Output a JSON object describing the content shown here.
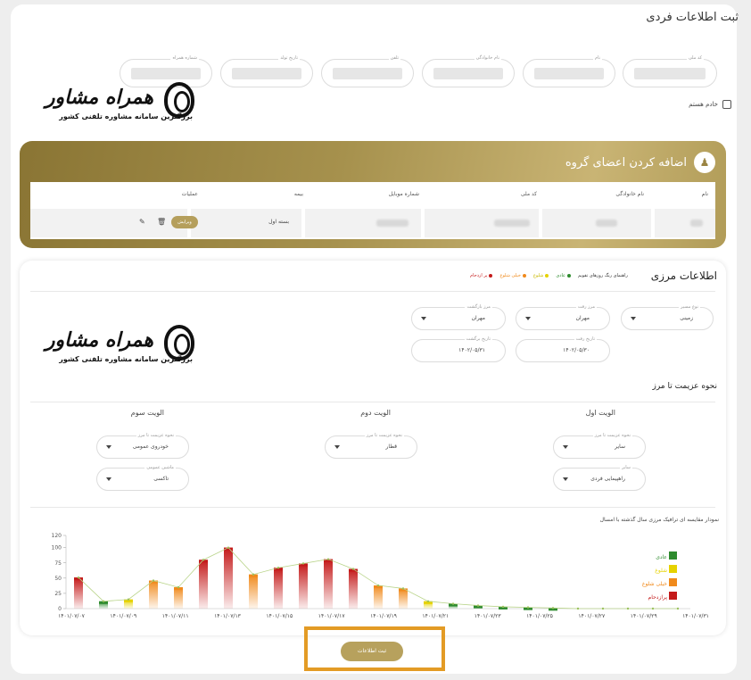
{
  "page_title": "ثبت اطلاعات فردی",
  "fields": [
    {
      "label": "کد ملی"
    },
    {
      "label": "نام"
    },
    {
      "label": "نام خانوادگی"
    },
    {
      "label": "تلفن"
    },
    {
      "label": "تاریخ تولد"
    },
    {
      "label": "شماره همراه"
    }
  ],
  "servant_checkbox_label": "خادم هستم",
  "watermark": {
    "brand": "همراه مشاور",
    "tagline": "بزرگترین سامانه مشاوره تلفنی کشور"
  },
  "group": {
    "title": "اضافه کردن اعضای گروه",
    "headers": {
      "name": "نام",
      "family": "نام خانوادگی",
      "national_code": "کد ملی",
      "mobile": "شماره موبایل",
      "insurance": "بیمه",
      "actions": "عملیات"
    },
    "row": {
      "insurance": "بسته اول",
      "edit_label": "ویرایش"
    }
  },
  "border": {
    "title": "اطلاعات مرزی",
    "legend": [
      {
        "label": "راهنمای رنگ روزهای تقویم",
        "color": ""
      },
      {
        "label": "عادی",
        "color": "#2e8b2e"
      },
      {
        "label": "شلوغ",
        "color": "#e6d200"
      },
      {
        "label": "خیلی شلوغ",
        "color": "#f08a1c"
      },
      {
        "label": "پر ازدحام",
        "color": "#c41a1a"
      }
    ],
    "selects": [
      {
        "label": "نوع مسیر",
        "value": "زمینی"
      },
      {
        "label": "مرز رفت",
        "value": "مهران"
      },
      {
        "label": "مرز بازگشت",
        "value": "مهران"
      }
    ],
    "dates": [
      {
        "label": "تاریخ رفت",
        "value": "۱۴۰۲/۰۵/۳۰"
      },
      {
        "label": "تاریخ برگشت",
        "value": "۱۴۰۲/۰۵/۳۱"
      }
    ],
    "priority_title": "نحوه عزیمت تا مرز",
    "priorities": [
      {
        "title": "الویت اول",
        "selects": [
          {
            "label": "نحوه عزیمت تا مرز",
            "value": "سایر"
          },
          {
            "label": "سایر",
            "value": "راهپیمایی فردی"
          }
        ]
      },
      {
        "title": "الویت دوم",
        "selects": [
          {
            "label": "نحوه عزیمت تا مرز",
            "value": "قطار"
          }
        ]
      },
      {
        "title": "الویت سوم",
        "selects": [
          {
            "label": "نحوه عزیمت تا مرز",
            "value": "خودروی عمومی"
          },
          {
            "label": "ماشین عمومی",
            "value": "تاکسی"
          }
        ]
      }
    ]
  },
  "chart_title": "نمودار مقایسه ای ترافیک مرزی سال گذشته با امسال",
  "chart_data": {
    "type": "bar",
    "title": "نمودار مقایسه ای ترافیک مرزی سال گذشته با امسال",
    "ylim": [
      0,
      120
    ],
    "yticks": [
      0,
      25,
      50,
      75,
      100,
      120
    ],
    "tick_labels": [
      "۱۴۰۱/۰۷/۰۷",
      "۱۴۰۱/۰۷/۰۹",
      "۱۴۰۱/۰۷/۱۱",
      "۱۴۰۱/۰۷/۱۳",
      "۱۴۰۱/۰۷/۱۵",
      "۱۴۰۱/۰۷/۱۷",
      "۱۴۰۱/۰۷/۱۹",
      "۱۴۰۱/۰۷/۲۱",
      "۱۴۰۱/۰۷/۲۳",
      "۱۴۰۱/۰۷/۲۵",
      "۱۴۰۱/۰۷/۲۷",
      "۱۴۰۱/۰۷/۲۹",
      "۱۴۰۱/۰۷/۳۱"
    ],
    "values": [
      51,
      12,
      15,
      46,
      35,
      80,
      100,
      56,
      67,
      74,
      81,
      65,
      38,
      33,
      12,
      8,
      5,
      3,
      2,
      1,
      0,
      0,
      0,
      0,
      0
    ],
    "bar_colors": [
      "#c41a1a",
      "#2e8b2e",
      "#e6d200",
      "#f08a1c",
      "#f08a1c",
      "#c41a1a",
      "#c41a1a",
      "#f08a1c",
      "#c41a1a",
      "#c41a1a",
      "#c41a1a",
      "#c41a1a",
      "#f08a1c",
      "#f08a1c",
      "#e6d200",
      "#2e8b2e",
      "#2e8b2e",
      "#2e8b2e",
      "#2e8b2e",
      "#2e8b2e",
      "#2e8b2e",
      "#2e8b2e",
      "#2e8b2e",
      "#2e8b2e",
      "#2e8b2e"
    ],
    "legend": [
      {
        "label": "عادی",
        "color": "#2e8b2e"
      },
      {
        "label": "شلوغ",
        "color": "#e6d200"
      },
      {
        "label": "خیلی شلوغ",
        "color": "#f08a1c"
      },
      {
        "label": "پرازدحام",
        "color": "#c41a1a"
      }
    ]
  },
  "submit_label": "ثبت اطلاعات"
}
